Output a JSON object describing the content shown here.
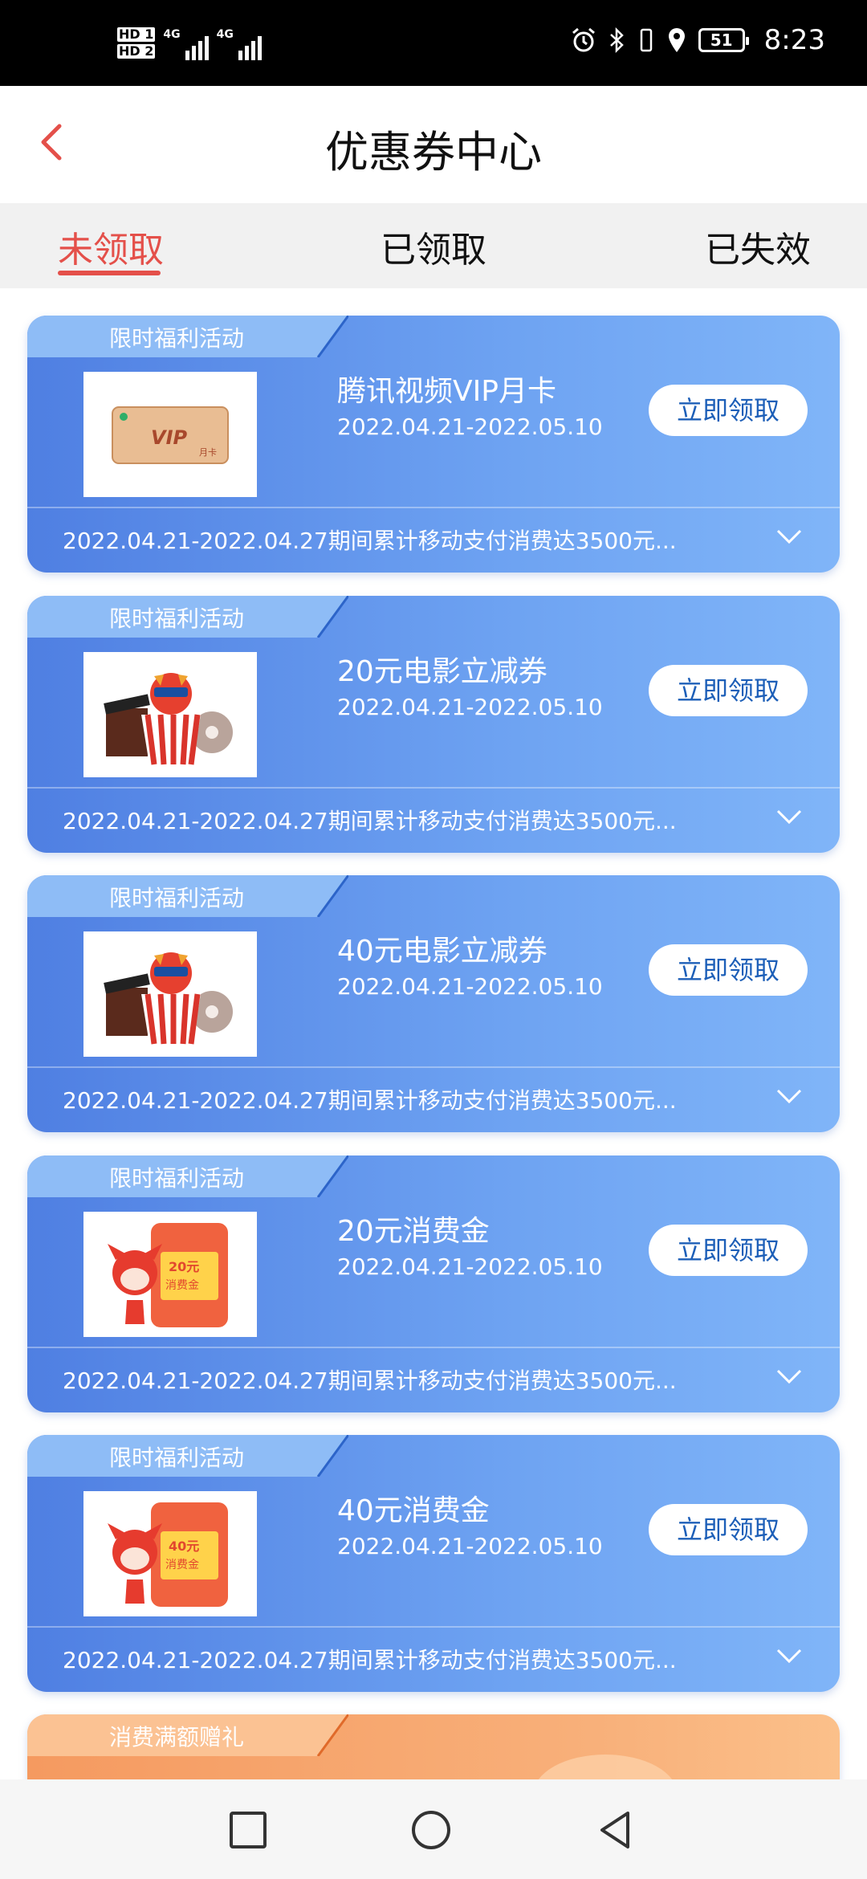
{
  "status_bar": {
    "hd1": "HD 1",
    "hd2": "HD 2",
    "net1": "4G",
    "net2": "4G",
    "battery": "51",
    "time": "8:23"
  },
  "header": {
    "title": "优惠券中心",
    "back_icon": "chevron-left-icon"
  },
  "tabs": [
    {
      "label": "未领取",
      "active": true
    },
    {
      "label": "已领取",
      "active": false
    },
    {
      "label": "已失效",
      "active": false
    }
  ],
  "coupons": [
    {
      "tag": "限时福利活动",
      "title": "腾讯视频VIP月卡",
      "date": "2022.04.21-2022.05.10",
      "button": "立即领取",
      "desc": "2022.04.21-2022.04.27期间累计移动支付消费达3500元...",
      "thumb": "vip-card",
      "thumb_label": "VIP",
      "thumb_sub": "月卡"
    },
    {
      "tag": "限时福利活动",
      "title": "20元电影立减券",
      "date": "2022.04.21-2022.05.10",
      "button": "立即领取",
      "desc": "2022.04.21-2022.04.27期间累计移动支付消费达3500元...",
      "thumb": "popcorn-movie"
    },
    {
      "tag": "限时福利活动",
      "title": "40元电影立减券",
      "date": "2022.04.21-2022.05.10",
      "button": "立即领取",
      "desc": "2022.04.21-2022.04.27期间累计移动支付消费达3500元...",
      "thumb": "popcorn-movie"
    },
    {
      "tag": "限时福利活动",
      "title": "20元消费金",
      "date": "2022.04.21-2022.05.10",
      "button": "立即领取",
      "desc": "2022.04.21-2022.04.27期间累计移动支付消费达3500元...",
      "thumb": "mascot-voucher",
      "thumb_label": "20元",
      "thumb_sub": "消费金"
    },
    {
      "tag": "限时福利活动",
      "title": "40元消费金",
      "date": "2022.04.21-2022.05.10",
      "button": "立即领取",
      "desc": "2022.04.21-2022.04.27期间累计移动支付消费达3500元...",
      "thumb": "mascot-voucher",
      "thumb_label": "40元",
      "thumb_sub": "消费金"
    }
  ],
  "partial_card": {
    "tag": "消费满额赠礼"
  },
  "colors": {
    "accent": "#e4504a",
    "card_blue": "#6ea3f2",
    "card_orange": "#f8b07a",
    "button_text": "#1d5fb8"
  },
  "navbar": {
    "icons": [
      "square-icon",
      "circle-home-icon",
      "triangle-back-icon"
    ]
  }
}
